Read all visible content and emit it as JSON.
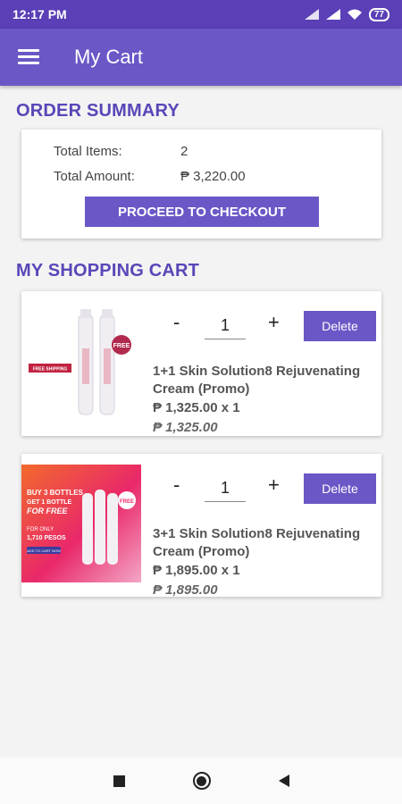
{
  "status_bar": {
    "time": "12:17 PM",
    "battery": "77"
  },
  "app_bar": {
    "title": "My Cart"
  },
  "order_summary": {
    "heading": "ORDER SUMMARY",
    "total_items_label": "Total Items:",
    "total_items_value": "2",
    "total_amount_label": "Total Amount:",
    "total_amount_value": "₱ 3,220.00",
    "checkout_label": "PROCEED TO CHECKOUT"
  },
  "cart": {
    "heading": "MY SHOPPING CART",
    "items": [
      {
        "quantity": "1",
        "delete_label": "Delete",
        "name": "1+1 Skin Solution8 Rejuvenating Cream (Promo)",
        "unit_price": "₱ 1,325.00 x 1",
        "total": "₱ 1,325.00",
        "badge_text": "FREE SHIPPING",
        "free_text": "FREE"
      },
      {
        "quantity": "1",
        "delete_label": "Delete",
        "name": "3+1 Skin Solution8 Rejuvenating Cream (Promo)",
        "unit_price": "₱ 1,895.00 x 1",
        "total": "₱ 1,895.00",
        "promo_line1": "BUY 3 BOTTLES",
        "promo_line2": "GET 1 BOTTLE",
        "promo_line3": "FOR FREE",
        "promo_line4": "FOR ONLY",
        "promo_line5": "1,710 PESOS",
        "promo_button": "ADD TO CART NOW",
        "free_text": "FREE"
      }
    ]
  },
  "stepper": {
    "minus": "-",
    "plus": "+"
  },
  "colors": {
    "status_bar": "#5a3fb6",
    "app_bar": "#6b57c6",
    "accent": "#5a46b8",
    "button": "#6b57c6"
  }
}
